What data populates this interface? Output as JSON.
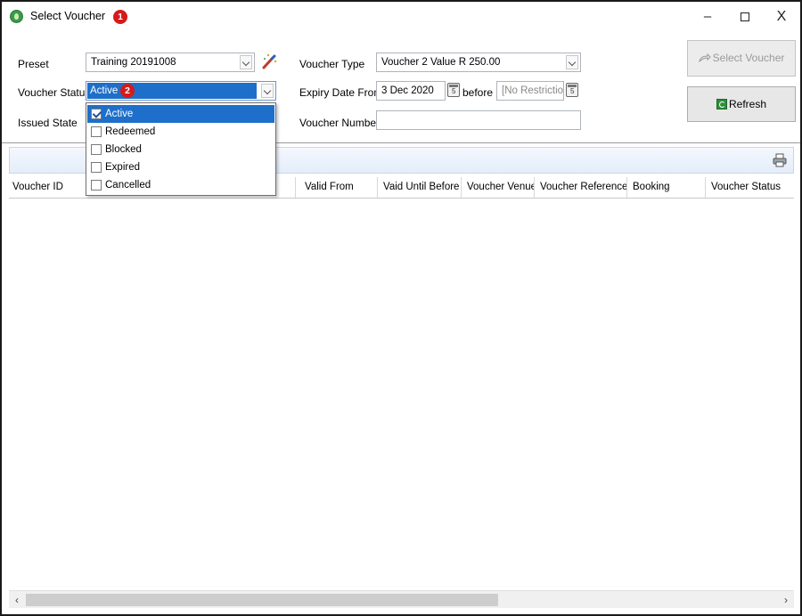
{
  "window": {
    "title": "Select Voucher",
    "annotation_1": "1",
    "controls": {
      "minimize": "–",
      "close": "X"
    }
  },
  "filters": {
    "preset_label": "Preset",
    "preset_value": "Training 20191008",
    "voucher_status_label": "Voucher Status",
    "voucher_status_value": "Active",
    "annotation_2": "2",
    "issued_state_label": "Issued State",
    "voucher_type_label": "Voucher Type",
    "voucher_type_value": "Voucher 2 Value R 250.00",
    "expiry_from_label": "Expiry Date From",
    "expiry_from_value": "3 Dec 2020",
    "before_label": "before",
    "expiry_before_value": "[No Restriction]",
    "voucher_number_label": "Voucher Number",
    "voucher_number_value": ""
  },
  "buttons": {
    "select_voucher": "Select Voucher",
    "refresh": "Refresh"
  },
  "status_dropdown": {
    "options": [
      {
        "label": "Active",
        "checked": true,
        "highlighted": true
      },
      {
        "label": "Redeemed",
        "checked": false
      },
      {
        "label": "Blocked",
        "checked": false
      },
      {
        "label": "Expired",
        "checked": false
      },
      {
        "label": "Cancelled",
        "checked": false
      }
    ]
  },
  "grid": {
    "columns": [
      "Voucher ID",
      "Valid From",
      "Vaid Until Before",
      "Voucher Venue",
      "Voucher Reference",
      "Booking",
      "Voucher Status"
    ]
  },
  "colors": {
    "selection": "#1e6fc9",
    "annotation_badge": "#d61a1a",
    "panel_gradient_top": "#f4f8fe"
  }
}
